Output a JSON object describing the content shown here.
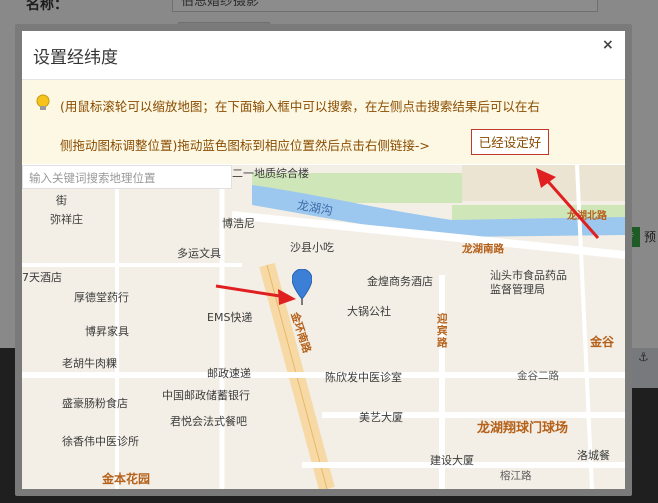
{
  "background": {
    "field_label": "名称：",
    "field_value": "伯恩婚纱摄影",
    "side_button_label": "专",
    "side_text": "预",
    "anchor_glyph": "⚓"
  },
  "dialog": {
    "title": "设置经纬度",
    "close_label": "×",
    "tip_line1": "(用鼠标滚轮可以缩放地图；在下面输入框中可以搜索，在左侧点击搜索结果后可以在右",
    "tip_line2": "侧拖动图标调整位置)拖动蓝色图标到相应位置然后点击右侧链接->",
    "done_label": "已经设定好"
  },
  "map": {
    "search_placeholder": "输入关键词搜索地理位置",
    "labels": [
      {
        "text": "二一地质综合楼",
        "style": "lbl"
      },
      {
        "text": "龙湖沟",
        "style": "lbl-blue"
      },
      {
        "text": "龙湖北路",
        "style": "lbl-brown"
      },
      {
        "text": "街",
        "style": "lbl"
      },
      {
        "text": "弥祥庄",
        "style": "lbl"
      },
      {
        "text": "博浩尼",
        "style": "lbl"
      },
      {
        "text": "沙县小吃",
        "style": "lbl"
      },
      {
        "text": "龙湖南路",
        "style": "lbl-brown"
      },
      {
        "text": "多运文具",
        "style": "lbl"
      },
      {
        "text": "7天酒店",
        "style": "lbl"
      },
      {
        "text": "金煌商务酒店",
        "style": "lbl"
      },
      {
        "text": "汕头市食品药品监督管理局",
        "style": "lbl"
      },
      {
        "text": "厚德堂药行",
        "style": "lbl"
      },
      {
        "text": "大锅公社",
        "style": "lbl"
      },
      {
        "text": "博昇家具",
        "style": "lbl"
      },
      {
        "text": "EMS快递",
        "style": "lbl"
      },
      {
        "text": "迎宾路",
        "style": "lbl-brown"
      },
      {
        "text": "金谷",
        "style": "lbl-brown"
      },
      {
        "text": "老胡牛肉粿",
        "style": "lbl"
      },
      {
        "text": "邮政速递",
        "style": "lbl"
      },
      {
        "text": "陈欣发中医诊室",
        "style": "lbl"
      },
      {
        "text": "金谷二路",
        "style": "lbl-road"
      },
      {
        "text": "盛豪肠粉食店",
        "style": "lbl"
      },
      {
        "text": "中国邮政储蓄银行",
        "style": "lbl"
      },
      {
        "text": "金环南路",
        "style": "lbl-brown"
      },
      {
        "text": "君悦会法式餐吧",
        "style": "lbl"
      },
      {
        "text": "美艺大厦",
        "style": "lbl"
      },
      {
        "text": "龙湖翔球门球场",
        "style": "lbl-brown"
      },
      {
        "text": "徐香伟中医诊所",
        "style": "lbl"
      },
      {
        "text": "建设大厦",
        "style": "lbl"
      },
      {
        "text": "洛城餐",
        "style": "lbl"
      },
      {
        "text": "金本花园",
        "style": "lbl-brown"
      },
      {
        "text": "榕江路",
        "style": "lbl-road"
      }
    ]
  },
  "colors": {
    "accent_blue": "#3b7fd6",
    "arrow_red": "#e02020",
    "tip_bg": "#fcf8e3",
    "tip_text": "#8a4b00"
  }
}
